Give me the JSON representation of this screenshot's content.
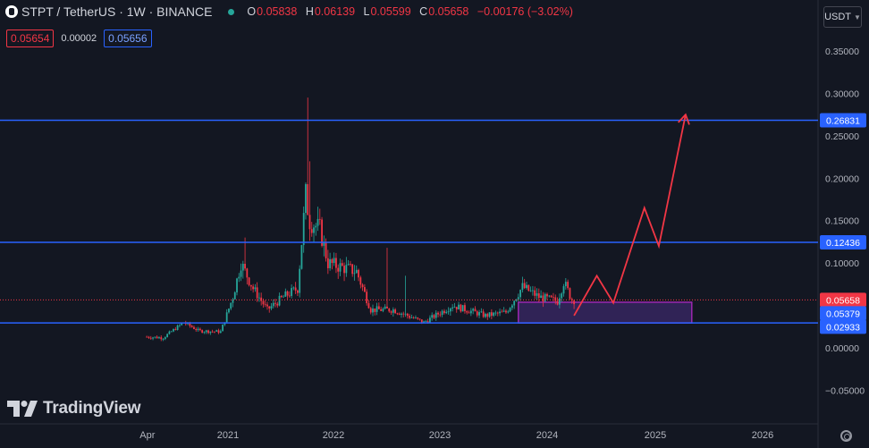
{
  "header": {
    "symbol": "STPT / TetherUS · 1W · BINANCE",
    "open_label": "O",
    "open": "0.05838",
    "high_label": "H",
    "high": "0.06139",
    "low_label": "L",
    "low": "0.05599",
    "close_label": "C",
    "close": "0.05658",
    "change": "−0.00176 (−3.02%)",
    "sell_price": "0.05654",
    "spread": "0.00002",
    "buy_price": "0.05656"
  },
  "currency": {
    "label": "USDT",
    "icon": "chevron-down-icon"
  },
  "logo": {
    "text": "TradingView"
  },
  "colors": {
    "background": "#131722",
    "up": "#26a69a",
    "down": "#f23645",
    "level_line": "#2962ff",
    "projection": "#f23645",
    "zone": "#9c27b0"
  },
  "chart_data": {
    "type": "candlestick",
    "timeframe": "1W",
    "x_ticks": [
      "Apr",
      "2021",
      "2022",
      "2023",
      "2024",
      "2025",
      "2026"
    ],
    "y_ticks": [
      "0.35000",
      "0.30000",
      "0.25000",
      "0.20000",
      "0.15000",
      "0.10000",
      "0.05000",
      "0.00000",
      "−0.05000"
    ],
    "ylim": [
      -0.06,
      0.37
    ],
    "horizontal_levels": [
      {
        "label": "0.26831",
        "value": 0.26831
      },
      {
        "label": "0.12436",
        "value": 0.12436
      },
      {
        "label": "0.02933",
        "value": 0.02933
      }
    ],
    "current_price": {
      "label": "0.05658",
      "value": 0.05658
    },
    "zone_label": "0.05379",
    "zone": {
      "from_date": "2023-09-25",
      "to_date": "2025-05-05",
      "y_low": 0.02933,
      "y_high": 0.05379
    },
    "projection_path": [
      {
        "date": "2024-04-01",
        "value": 0.038
      },
      {
        "date": "2024-06-17",
        "value": 0.085
      },
      {
        "date": "2024-08-12",
        "value": 0.053
      },
      {
        "date": "2024-11-25",
        "value": 0.165
      },
      {
        "date": "2025-01-13",
        "value": 0.12
      },
      {
        "date": "2025-04-14",
        "value": 0.275
      }
    ],
    "series": [
      {
        "date_range": [
          "2020-03-30",
          "2024-04-01"
        ],
        "shape_anchors": [
          {
            "date": "2020-03-30",
            "value": 0.013
          },
          {
            "date": "2020-06-01",
            "value": 0.012
          },
          {
            "date": "2020-08-10",
            "value": 0.03
          },
          {
            "date": "2020-10-01",
            "value": 0.02
          },
          {
            "date": "2020-12-14",
            "value": 0.019
          },
          {
            "date": "2021-01-25",
            "value": 0.06
          },
          {
            "date": "2021-02-22",
            "value": 0.1
          },
          {
            "date": "2021-04-05",
            "value": 0.07
          },
          {
            "date": "2021-05-24",
            "value": 0.045
          },
          {
            "date": "2021-07-19",
            "value": 0.06
          },
          {
            "date": "2021-09-06",
            "value": 0.07
          },
          {
            "date": "2021-10-04",
            "value": 0.18
          },
          {
            "date": "2021-10-18",
            "value": 0.15
          },
          {
            "date": "2021-11-22",
            "value": 0.14
          },
          {
            "date": "2021-12-20",
            "value": 0.1
          },
          {
            "date": "2022-02-07",
            "value": 0.095
          },
          {
            "date": "2022-03-28",
            "value": 0.09
          },
          {
            "date": "2022-05-16",
            "value": 0.045
          },
          {
            "date": "2022-08-01",
            "value": 0.045
          },
          {
            "date": "2022-11-14",
            "value": 0.03
          },
          {
            "date": "2023-02-20",
            "value": 0.05
          },
          {
            "date": "2023-06-12",
            "value": 0.038
          },
          {
            "date": "2023-08-21",
            "value": 0.042
          },
          {
            "date": "2023-10-16",
            "value": 0.072
          },
          {
            "date": "2023-12-11",
            "value": 0.06
          },
          {
            "date": "2024-02-12",
            "value": 0.055
          },
          {
            "date": "2024-03-04",
            "value": 0.078
          },
          {
            "date": "2024-04-01",
            "value": 0.0566
          }
        ],
        "spikes": [
          {
            "date": "2021-10-04",
            "high": 0.295
          },
          {
            "date": "2021-10-11",
            "high": 0.22
          },
          {
            "date": "2021-03-01",
            "high": 0.13
          },
          {
            "date": "2022-07-04",
            "high": 0.118
          },
          {
            "date": "2022-09-05",
            "high": 0.085
          }
        ]
      }
    ]
  }
}
